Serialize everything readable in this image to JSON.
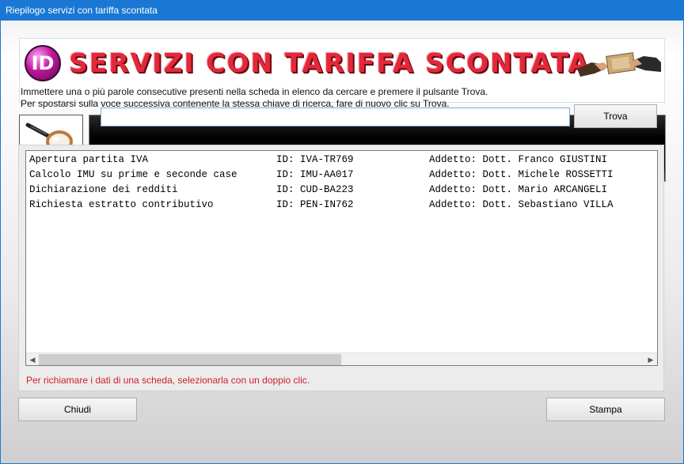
{
  "window": {
    "title": "Riepilogo servizi con tariffa scontata"
  },
  "banner": {
    "logo_text": "ID",
    "title": "SERVIZI CON TARIFFA SCONTATA"
  },
  "instructions": {
    "line1": "Immettere una o più parole consecutive presenti nella scheda in elenco da cercare e premere il pulsante Trova.",
    "line2": "Per spostarsi sulla voce successiva contenente la stessa chiave di ricerca, fare di nuovo clic su Trova."
  },
  "search": {
    "value": "",
    "button_label": "Trova"
  },
  "list": {
    "rows": [
      {
        "service": "Apertura partita IVA",
        "id": "ID: IVA-TR769",
        "addetto": "Addetto: Dott. Franco GIUSTINI"
      },
      {
        "service": "Calcolo IMU su prime e seconde case",
        "id": "ID: IMU-AA017",
        "addetto": "Addetto: Dott. Michele ROSSETTI"
      },
      {
        "service": "Dichiarazione dei redditi",
        "id": "ID: CUD-BA223",
        "addetto": "Addetto: Dott. Mario ARCANGELI"
      },
      {
        "service": "Richiesta estratto contributivo",
        "id": "ID: PEN-IN762",
        "addetto": "Addetto: Dott. Sebastiano VILLA"
      }
    ]
  },
  "hint": "Per richiamare i dati di una scheda, selezionarla con un doppio clic.",
  "buttons": {
    "close_label": "Chiudi",
    "print_label": "Stampa"
  },
  "icons": {
    "banner_logo": "id-logo-icon",
    "banner_image": "hands-money-icon",
    "search": "magnifier-icon",
    "scroll_left": "arrow-left-icon",
    "scroll_right": "arrow-right-icon"
  },
  "colors": {
    "titlebar": "#1a78d4",
    "banner_text": "#e2283a",
    "hint_text": "#d0202a"
  }
}
